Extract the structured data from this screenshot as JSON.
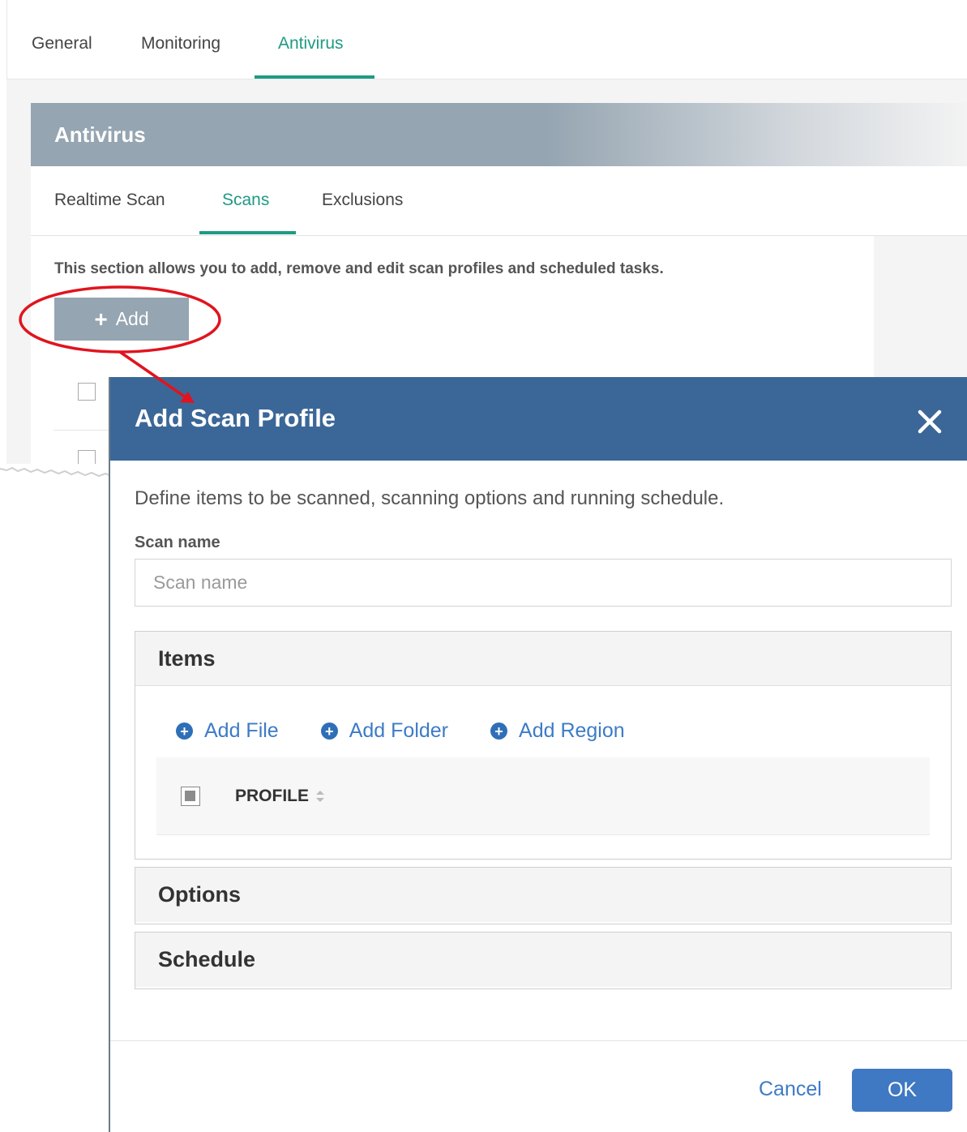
{
  "top_tabs": [
    {
      "label": "General"
    },
    {
      "label": "Monitoring"
    },
    {
      "label": "Antivirus"
    }
  ],
  "antivirus": {
    "title": "Antivirus",
    "sub_tabs": [
      {
        "label": "Realtime Scan"
      },
      {
        "label": "Scans"
      },
      {
        "label": "Exclusions"
      }
    ],
    "description": "This section allows you to add, remove and edit scan profiles and scheduled tasks.",
    "add_label": "Add"
  },
  "dialog": {
    "title": "Add Scan Profile",
    "description": "Define items to be scanned, scanning options and running schedule.",
    "scan_name": {
      "label": "Scan name",
      "placeholder": "Scan name",
      "value": ""
    },
    "items": {
      "title": "Items",
      "links": [
        {
          "label": "Add File"
        },
        {
          "label": "Add Folder"
        },
        {
          "label": "Add Region"
        }
      ],
      "column_header": "PROFILE"
    },
    "options_title": "Options",
    "schedule_title": "Schedule",
    "cancel_label": "Cancel",
    "ok_label": "OK"
  },
  "colors": {
    "accent_green": "#1f9a85",
    "dialog_header": "#3b6798",
    "link_blue": "#3d7bc6",
    "ok_button": "#3f78c3",
    "annotation_red": "#e0141e"
  }
}
